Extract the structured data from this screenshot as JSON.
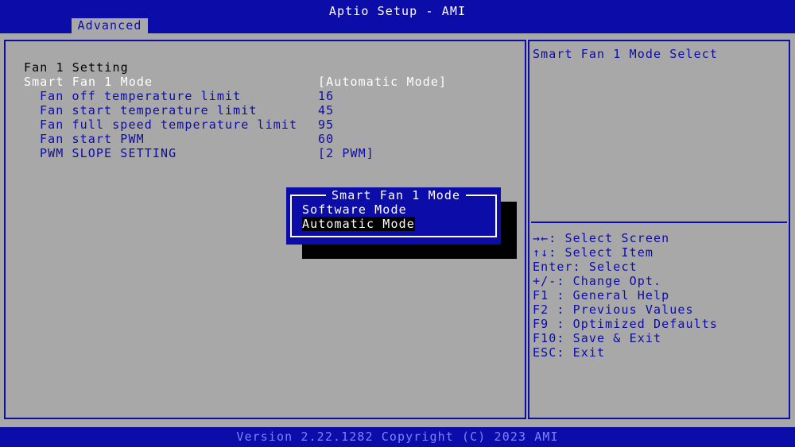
{
  "title": "Aptio Setup - AMI",
  "tab": "Advanced",
  "section_heading": "Fan 1 Setting",
  "settings": [
    {
      "label": "Smart Fan 1 Mode",
      "value": "[Automatic Mode]"
    },
    {
      "label": "Fan off temperature limit",
      "value": "16"
    },
    {
      "label": "Fan start temperature limit",
      "value": "45"
    },
    {
      "label": "Fan full speed temperature limit",
      "value": "95"
    },
    {
      "label": "Fan start PWM",
      "value": "60"
    },
    {
      "label": "PWM SLOPE SETTING",
      "value": "[2 PWM]"
    }
  ],
  "help_text": "Smart Fan 1 Mode Select",
  "keys": [
    "→←: Select Screen",
    "↑↓: Select Item",
    "Enter: Select",
    "+/-: Change Opt.",
    "F1 : General Help",
    "F2 : Previous Values",
    "F9 : Optimized Defaults",
    "F10: Save & Exit",
    "ESC: Exit"
  ],
  "popup": {
    "title": "Smart Fan 1 Mode",
    "options": [
      "Software Mode",
      "Automatic Mode"
    ],
    "selected_index": 1
  },
  "footer": "Version 2.22.1282 Copyright (C) 2023 AMI",
  "colors": {
    "background": "#a8a8a8",
    "accent": "#0c0ca8",
    "highlight": "#ffffff"
  }
}
